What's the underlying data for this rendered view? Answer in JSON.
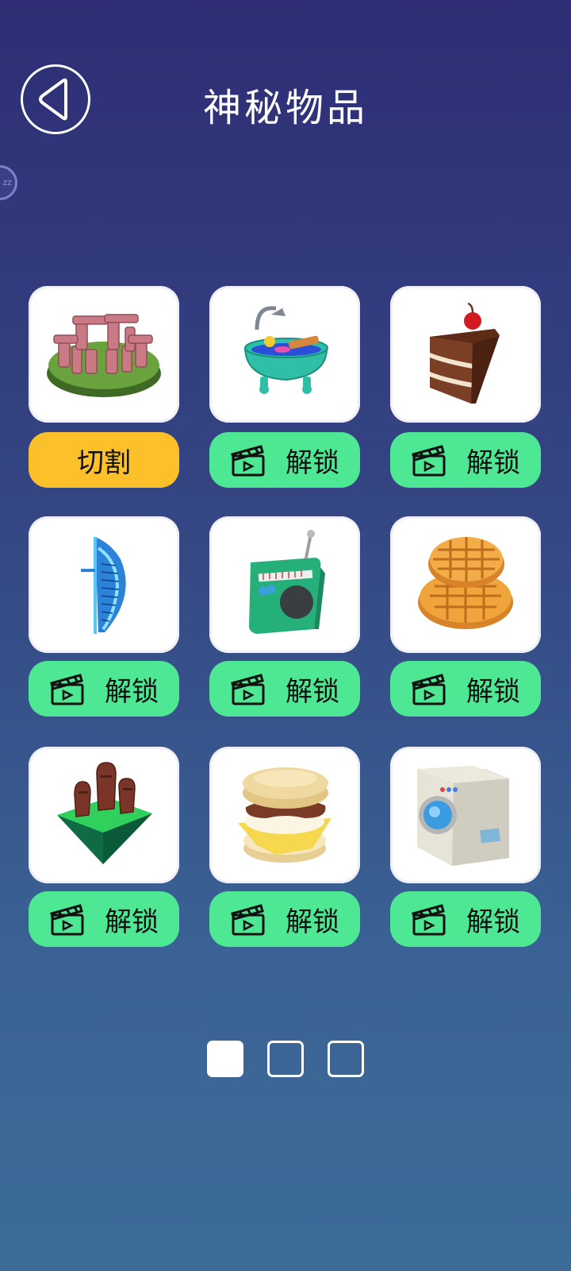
{
  "header": {
    "title": "神秘物品",
    "back_icon": "back-arrow-icon"
  },
  "side_badge": {
    "text": "zz"
  },
  "colors": {
    "unlock_button": "#4ee895",
    "cut_button": "#fcc12a"
  },
  "items": [
    {
      "name": "stonehenge",
      "action_label": "切割",
      "action": "cut"
    },
    {
      "name": "bathtub",
      "action_label": "解锁",
      "action": "unlock"
    },
    {
      "name": "cake-slice",
      "action_label": "解锁",
      "action": "unlock"
    },
    {
      "name": "burj-al-arab",
      "action_label": "解锁",
      "action": "unlock"
    },
    {
      "name": "radio",
      "action_label": "解锁",
      "action": "unlock"
    },
    {
      "name": "waffles",
      "action_label": "解锁",
      "action": "unlock"
    },
    {
      "name": "moai",
      "action_label": "解锁",
      "action": "unlock"
    },
    {
      "name": "breakfast-sandwich",
      "action_label": "解锁",
      "action": "unlock"
    },
    {
      "name": "washing-machine",
      "action_label": "解锁",
      "action": "unlock"
    }
  ],
  "pagination": {
    "pages": 3,
    "current": 1
  }
}
